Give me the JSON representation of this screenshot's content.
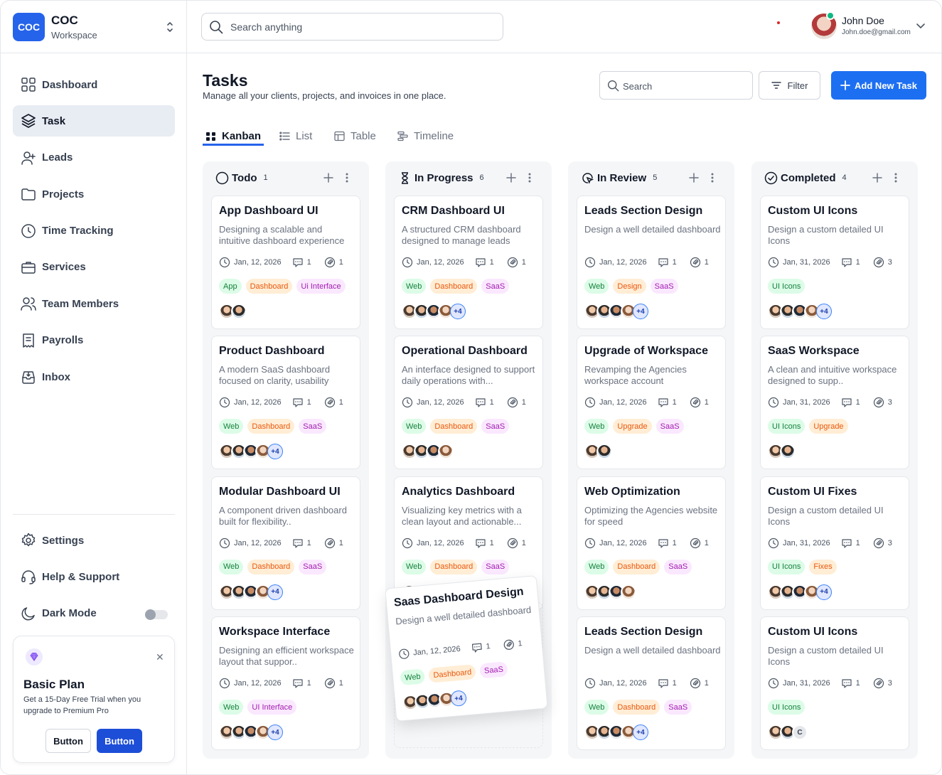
{
  "workspace": {
    "logo": "COC",
    "name": "COC",
    "subtitle": "Workspace"
  },
  "search": {
    "placeholder": "Search anything"
  },
  "user": {
    "name": "John Doe",
    "email": "John.doe@gmail.com"
  },
  "sidebar": {
    "items": [
      {
        "label": "Dashboard",
        "icon": "grid-icon"
      },
      {
        "label": "Task",
        "icon": "layers-icon",
        "active": true
      },
      {
        "label": "Leads",
        "icon": "user-plus-icon"
      },
      {
        "label": "Projects",
        "icon": "folder-icon"
      },
      {
        "label": "Time Tracking",
        "icon": "clock-icon"
      },
      {
        "label": "Services",
        "icon": "briefcase-icon"
      },
      {
        "label": "Team Members",
        "icon": "users-icon"
      },
      {
        "label": "Payrolls",
        "icon": "receipt-icon"
      },
      {
        "label": "Inbox",
        "icon": "inbox-icon"
      }
    ],
    "bottom": [
      {
        "label": "Settings",
        "icon": "gear-icon"
      },
      {
        "label": "Help & Support",
        "icon": "headset-icon"
      },
      {
        "label": "Dark Mode",
        "icon": "moon-icon",
        "toggle": false
      }
    ],
    "plan": {
      "title": "Basic Plan",
      "description": "Get a 15-Day Free Trial when you upgrade to Premium Pro",
      "button_secondary": "Button",
      "button_primary": "Button"
    }
  },
  "page": {
    "title": "Tasks",
    "subtitle": "Manage all your clients, projects, and invoices in one place.",
    "search_placeholder": "Search",
    "filter_label": "Filter",
    "add_label": "Add New Task",
    "tabs": [
      {
        "label": "Kanban",
        "active": true
      },
      {
        "label": "List"
      },
      {
        "label": "Table"
      },
      {
        "label": "Timeline"
      }
    ]
  },
  "colors": {
    "accent": "#2563eb",
    "tag_green": "#15803d",
    "tag_orange": "#ea580c",
    "tag_purple": "#a21caf"
  },
  "columns": [
    {
      "title": "Todo",
      "count": "1",
      "icon": "circle-icon",
      "cards": [
        {
          "title": "App Dashboard UI",
          "desc": "Designing a scalable and intuitive dashboard experience",
          "date": "Jan, 12, 2026",
          "comments": "1",
          "attachments": "1",
          "tags": [
            [
              "App",
              "green"
            ],
            [
              "Dashboard",
              "orange"
            ],
            [
              "Ui Interface",
              "purple"
            ]
          ],
          "avatars": 2,
          "more": ""
        },
        {
          "title": "Product Dashboard",
          "desc": "A modern SaaS dashboard focused on clarity, usability",
          "date": "Jan, 12, 2026",
          "comments": "1",
          "attachments": "1",
          "tags": [
            [
              "Web",
              "green"
            ],
            [
              "Dashboard",
              "orange"
            ],
            [
              "SaaS",
              "purple"
            ]
          ],
          "avatars": 4,
          "more": "+4"
        },
        {
          "title": "Modular Dashboard UI",
          "desc": "A component driven dashboard built for flexibility..",
          "date": "Jan, 12, 2026",
          "comments": "1",
          "attachments": "1",
          "tags": [
            [
              "Web",
              "green"
            ],
            [
              "Dashboard",
              "orange"
            ],
            [
              "SaaS",
              "purple"
            ]
          ],
          "avatars": 4,
          "more": "+4"
        },
        {
          "title": "Workspace Interface",
          "desc": "Designing an efficient workspace layout that suppor..",
          "date": "Jan, 12, 2026",
          "comments": "1",
          "attachments": "1",
          "tags": [
            [
              "Web",
              "green"
            ],
            [
              "UI Interface",
              "purple"
            ]
          ],
          "avatars": 4,
          "more": "+4"
        }
      ]
    },
    {
      "title": "In Progress",
      "count": "6",
      "icon": "hourglass-icon",
      "cards": [
        {
          "title": "CRM Dashboard UI",
          "desc": "A structured CRM dashboard designed to manage leads",
          "date": "Jan, 12, 2026",
          "comments": "1",
          "attachments": "1",
          "tags": [
            [
              "Web",
              "green"
            ],
            [
              "Dashboard",
              "orange"
            ],
            [
              "SaaS",
              "purple"
            ]
          ],
          "avatars": 4,
          "more": "+4"
        },
        {
          "title": "Operational Dashboard",
          "desc": "An interface designed to support daily operations with...",
          "date": "Jan, 12, 2026",
          "comments": "1",
          "attachments": "1",
          "tags": [
            [
              "Web",
              "green"
            ],
            [
              "Dashboard",
              "orange"
            ],
            [
              "SaaS",
              "purple"
            ]
          ],
          "avatars": 4,
          "more": ""
        },
        {
          "title": "Analytics Dashboard",
          "desc": "Visualizing key metrics with a clean layout and actionable...",
          "date": "Jan, 12, 2026",
          "comments": "1",
          "attachments": "1",
          "tags": [
            [
              "Web",
              "green"
            ],
            [
              "Dashboard",
              "orange"
            ],
            [
              "SaaS",
              "purple"
            ]
          ],
          "avatars": 4,
          "more": ""
        }
      ],
      "dragging": {
        "title": "Saas Dashboard Design",
        "desc": "Design a well detailed dashboard",
        "date": "Jan, 12, 2026",
        "comments": "1",
        "attachments": "1",
        "tags": [
          [
            "Web",
            "green"
          ],
          [
            "Dashboard",
            "orange"
          ],
          [
            "SaaS",
            "purple"
          ]
        ],
        "avatars": 4,
        "more": "+4"
      }
    },
    {
      "title": "In Review",
      "count": "5",
      "icon": "review-icon",
      "cards": [
        {
          "title": "Leads Section Design",
          "desc": "Design a well detailed dashboard",
          "date": "Jan, 12, 2026",
          "comments": "1",
          "attachments": "1",
          "tags": [
            [
              "Web",
              "green"
            ],
            [
              "Design",
              "orange"
            ],
            [
              "SaaS",
              "purple"
            ]
          ],
          "avatars": 4,
          "more": "+4"
        },
        {
          "title": "Upgrade of Workspace",
          "desc": "Revamping the Agencies workspace account",
          "date": "Jan, 12, 2026",
          "comments": "1",
          "attachments": "1",
          "tags": [
            [
              "Web",
              "green"
            ],
            [
              "Upgrade",
              "orange"
            ],
            [
              "SaaS",
              "purple"
            ]
          ],
          "avatars": 2,
          "more": ""
        },
        {
          "title": "Web Optimization",
          "desc": "Optimizing the Agencies website for speed",
          "date": "Jan, 12, 2026",
          "comments": "1",
          "attachments": "1",
          "tags": [
            [
              "Web",
              "green"
            ],
            [
              "Dashboard",
              "orange"
            ],
            [
              "SaaS",
              "purple"
            ]
          ],
          "avatars": 4,
          "more": ""
        },
        {
          "title": "Leads Section Design",
          "desc": "Design a well detailed dashboard",
          "date": "Jan, 12, 2026",
          "comments": "1",
          "attachments": "1",
          "tags": [
            [
              "Web",
              "green"
            ],
            [
              "Dashboard",
              "orange"
            ],
            [
              "SaaS",
              "purple"
            ]
          ],
          "avatars": 4,
          "more": "+4"
        }
      ]
    },
    {
      "title": "Completed",
      "count": "4",
      "icon": "check-circle-icon",
      "cards": [
        {
          "title": "Custom UI Icons",
          "desc": "Design a custom detailed UI Icons",
          "date": "Jan, 31, 2026",
          "comments": "1",
          "attachments": "3",
          "tags": [
            [
              "UI Icons",
              "green"
            ]
          ],
          "avatars": 4,
          "more": "+4"
        },
        {
          "title": "SaaS Workspace",
          "desc": "A clean and intuitive workspace designed to supp..",
          "date": "Jan, 31, 2026",
          "comments": "1",
          "attachments": "3",
          "tags": [
            [
              "UI Icons",
              "green"
            ],
            [
              "Upgrade",
              "orange"
            ]
          ],
          "avatars": 2,
          "more": ""
        },
        {
          "title": "Custom UI Fixes",
          "desc": "Design a custom detailed UI Icons",
          "date": "Jan, 31, 2026",
          "comments": "1",
          "attachments": "3",
          "tags": [
            [
              "UI Icons",
              "green"
            ],
            [
              "Fixes",
              "orange"
            ]
          ],
          "avatars": 4,
          "more": "+4"
        },
        {
          "title": "Custom UI Icons",
          "desc": "Design a custom detailed UI Icons",
          "date": "Jan, 31, 2026",
          "comments": "1",
          "attachments": "3",
          "tags": [
            [
              "UI Icons",
              "green"
            ]
          ],
          "avatars": 2,
          "more": "C"
        }
      ]
    }
  ]
}
